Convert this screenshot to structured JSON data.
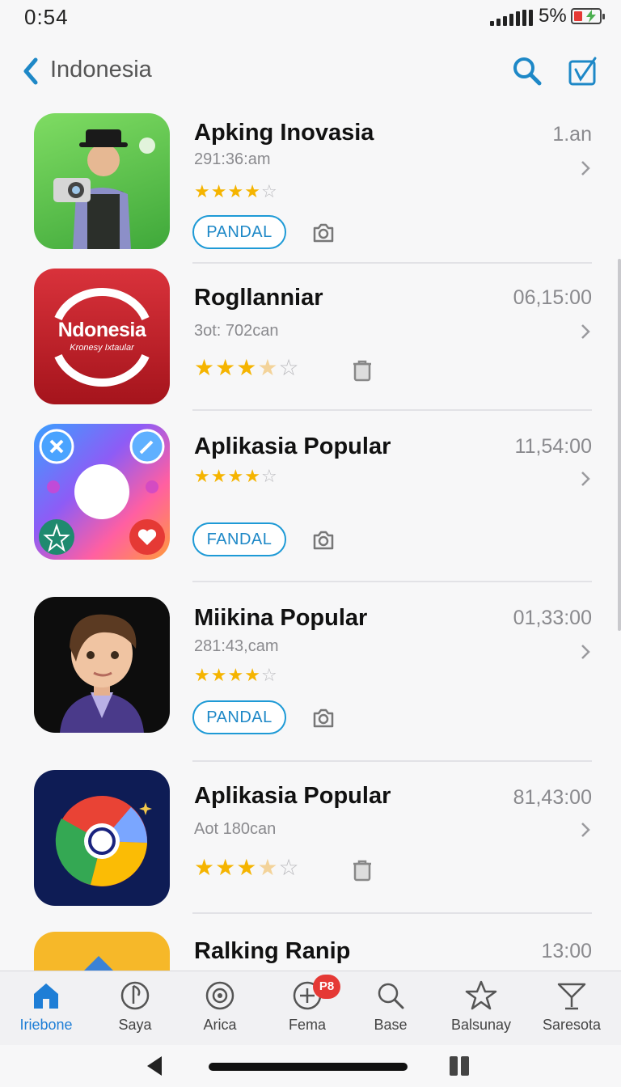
{
  "status_bar": {
    "time": "0:54",
    "battery_percent": "5%"
  },
  "nav": {
    "back_icon": "chevron-left-icon",
    "title": "Indonesia",
    "search_icon": "search-icon",
    "compose_icon": "edit-icon"
  },
  "colors": {
    "accent": "#1e88c7",
    "star": "#f5b400",
    "badge": "#e53935"
  },
  "apps": [
    {
      "name": "Apking Inovasia",
      "subtitle": "291:36:am",
      "time": "1.an",
      "rating": 4,
      "button": "PANDAL",
      "aux_icon": "camera-icon"
    },
    {
      "name": "Rogllanniar",
      "subtitle": "3ot: 702can",
      "time": "06,15:00",
      "rating": 3.5,
      "aux_icon": "trash-icon",
      "icon_text": "Ndonesia",
      "icon_subtext": "Kronesy Ixtaular"
    },
    {
      "name": "Aplikasia Popular",
      "subtitle": "",
      "time": "11,54:00",
      "rating": 4,
      "button": "FANDAL",
      "aux_icon": "camera-icon"
    },
    {
      "name": "Miikina Popular",
      "subtitle": "281:43,cam",
      "time": "01,33:00",
      "rating": 4,
      "button": "PANDAL",
      "aux_icon": "camera-icon"
    },
    {
      "name": "Aplikasia Popular",
      "subtitle": "Aot 180can",
      "time": "81,43:00",
      "rating": 3.5,
      "aux_icon": "trash-icon"
    },
    {
      "name": "Ralking Ranip",
      "subtitle": "",
      "time": "13:00"
    }
  ],
  "tabs": [
    {
      "label": "Iriebone",
      "icon": "home-icon",
      "active": true
    },
    {
      "label": "Saya",
      "icon": "music-icon"
    },
    {
      "label": "Arica",
      "icon": "disc-icon"
    },
    {
      "label": "Fema",
      "icon": "plus-circle-icon",
      "badge": "P8"
    },
    {
      "label": "Base",
      "icon": "search-icon"
    },
    {
      "label": "Balsunay",
      "icon": "star-icon"
    },
    {
      "label": "Saresota",
      "icon": "cocktail-icon"
    }
  ]
}
